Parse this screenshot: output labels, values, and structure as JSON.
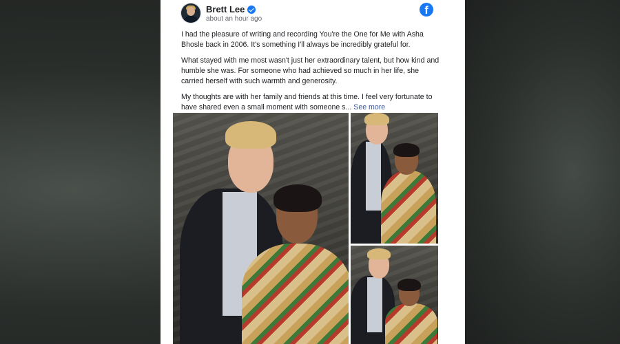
{
  "post": {
    "author": "Brett Lee",
    "timestamp": "about an hour ago",
    "paragraphs": [
      "I had the pleasure of writing and recording You're the One for Me with Asha Bhosle back in 2006. It's something I'll always be incredibly grateful for.",
      "What stayed with me most wasn't just her extraordinary talent, but how kind and humble she was. For someone who had achieved so much in her life, she carried herself with such warmth and generosity.",
      "My thoughts are with her family and friends at this time. I feel very fortunate to have shared even a small moment with someone s..."
    ],
    "see_more": "See more",
    "platform_icon": "f"
  },
  "icons": {
    "verified": "verified-badge-icon",
    "platform": "facebook-icon"
  },
  "colors": {
    "facebook_blue": "#1877f2",
    "link": "#385898",
    "text": "#1c1e21",
    "secondary_text": "#65676b"
  }
}
